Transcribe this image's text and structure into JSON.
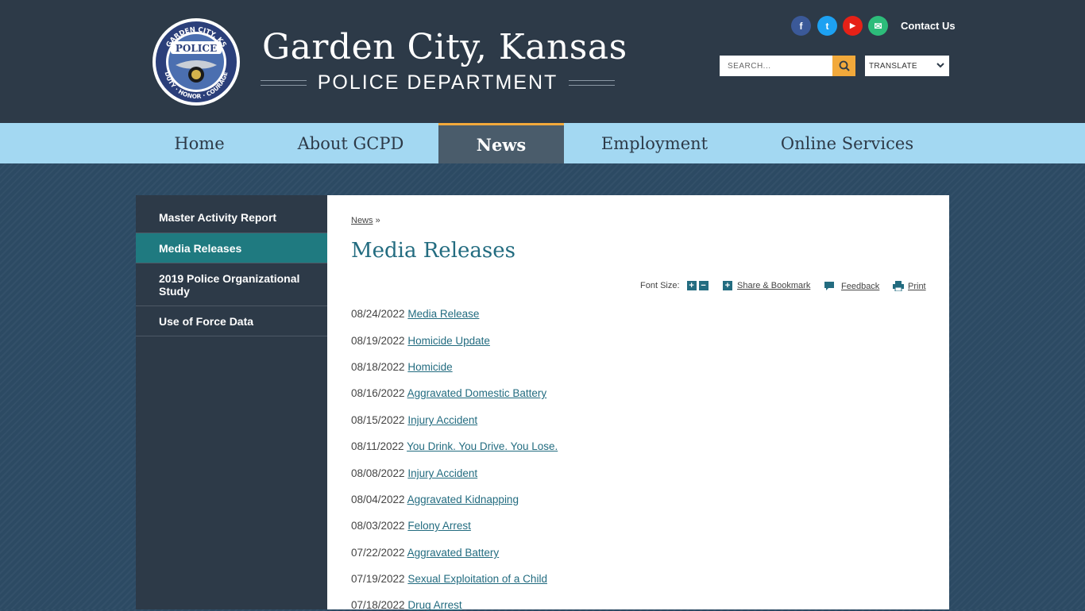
{
  "header": {
    "title": "Garden City, Kansas",
    "subtitle": "POLICE DEPARTMENT",
    "badge": {
      "top_text": "GARDEN CITY, KS",
      "center_text": "POLICE",
      "bottom_text": "DUTY · HONOR · COURAGE"
    },
    "social": [
      {
        "icon": "facebook-icon",
        "glyph": "f",
        "color": "#3b5998"
      },
      {
        "icon": "twitter-icon",
        "glyph": "t",
        "color": "#1da1f2"
      },
      {
        "icon": "youtube-icon",
        "glyph": "▶",
        "color": "#e62117"
      },
      {
        "icon": "email-icon",
        "glyph": "✉",
        "color": "#2dbc7a"
      }
    ],
    "contact_label": "Contact Us",
    "search_placeholder": "SEARCH...",
    "translate_label": "TRANSLATE"
  },
  "nav": {
    "items": [
      {
        "label": "Home"
      },
      {
        "label": "About GCPD"
      },
      {
        "label": "News",
        "active": true
      },
      {
        "label": "Employment"
      },
      {
        "label": "Online Services"
      }
    ]
  },
  "sidebar": {
    "items": [
      {
        "label": "Master Activity Report"
      },
      {
        "label": "Media Releases",
        "active": true
      },
      {
        "label": "2019 Police Organizational Study"
      },
      {
        "label": "Use of Force Data"
      }
    ]
  },
  "content": {
    "breadcrumb": {
      "link": "News",
      "sep": "»"
    },
    "title": "Media Releases",
    "tools": {
      "font_size_label": "Font Size:",
      "share_label": "Share & Bookmark",
      "feedback_label": "Feedback",
      "print_label": "Print"
    },
    "releases": [
      {
        "date": "08/24/2022",
        "title": "Media Release "
      },
      {
        "date": "08/19/2022",
        "title": "Homicide Update "
      },
      {
        "date": "08/18/2022",
        "title": "Homicide "
      },
      {
        "date": "08/16/2022",
        "title": "Aggravated Domestic Battery"
      },
      {
        "date": "08/15/2022",
        "title": "Injury Accident "
      },
      {
        "date": "08/11/2022",
        "title": "You Drink. You Drive. You Lose. "
      },
      {
        "date": "08/08/2022",
        "title": "Injury Accident "
      },
      {
        "date": "08/04/2022",
        "title": "Aggravated Kidnapping "
      },
      {
        "date": "08/03/2022",
        "title": "Felony Arrest "
      },
      {
        "date": "07/22/2022",
        "title": "Aggravated Battery "
      },
      {
        "date": "07/19/2022",
        "title": "Sexual Exploitation of a Child "
      },
      {
        "date": "07/18/2022",
        "title": "Drug Arrest"
      }
    ]
  },
  "colors": {
    "header_bg": "#2d3a48",
    "nav_bg": "#a3d8f2",
    "accent_orange": "#f2a93b",
    "teal": "#1f7a80",
    "link": "#236c80"
  }
}
